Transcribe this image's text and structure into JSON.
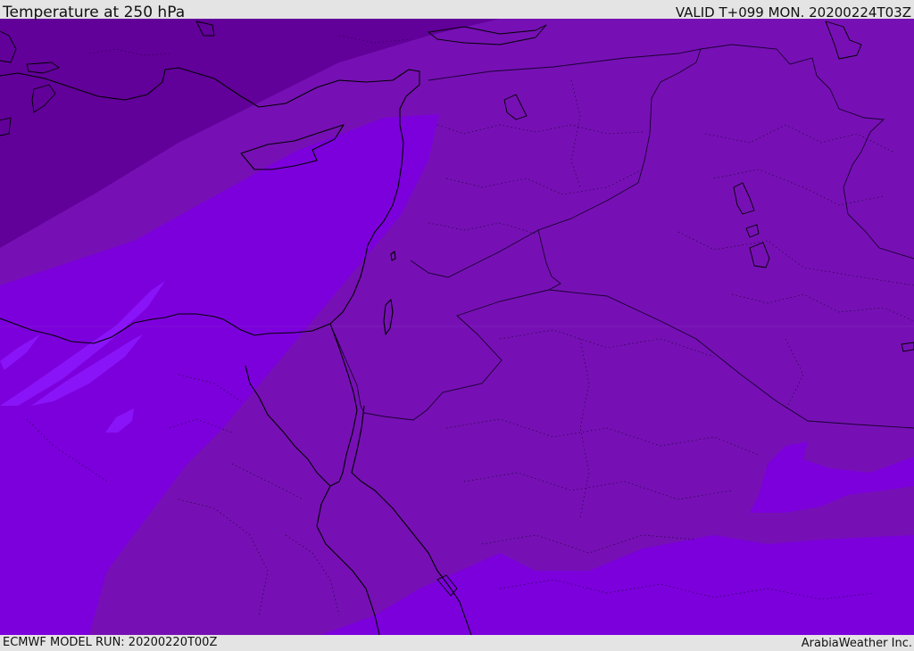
{
  "header": {
    "title": "Temperature at 250 hPa",
    "valid": "VALID T+099 MON. 20200224T03Z"
  },
  "footer": {
    "model_run": "ECMWF MODEL RUN: 20200220T00Z",
    "credit": "ArabiaWeather Inc."
  },
  "colors": {
    "band_coldest": "#62009a",
    "band_cold": "#7610b4",
    "band_mild": "#7c00dc",
    "band_warm": "#8a14f8",
    "coastline": "#000000",
    "border": "#1a0030"
  }
}
